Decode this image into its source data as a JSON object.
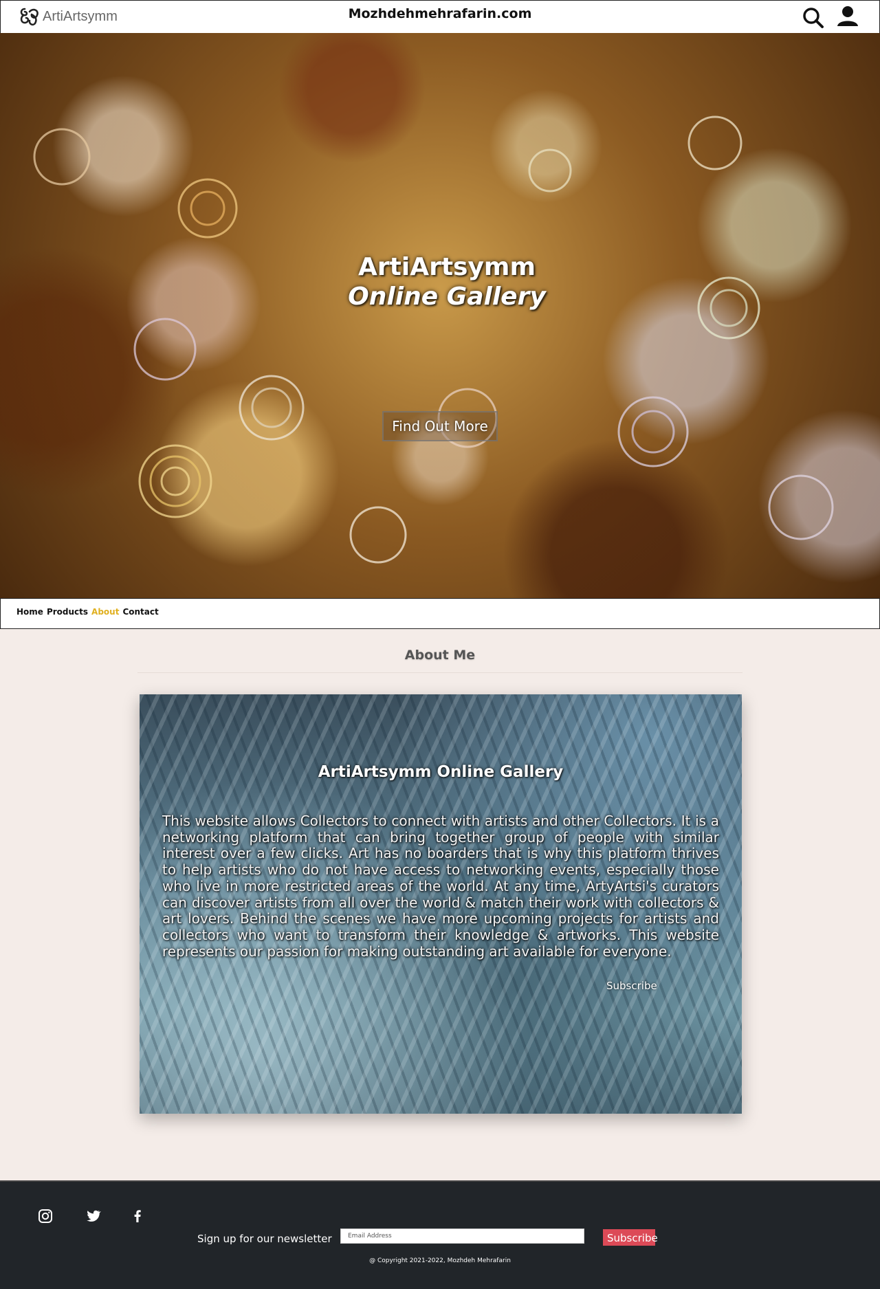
{
  "header": {
    "logo_text": "ArtiArtsymm",
    "site_title": "Mozhdehmehrafarin.com",
    "icons": [
      "search-icon",
      "user-icon"
    ]
  },
  "hero": {
    "line1": "ArtiArtsymm",
    "line2": "Online Gallery",
    "button_label": "Find Out More"
  },
  "nav": {
    "items": [
      {
        "label": "Home"
      },
      {
        "label": "Products"
      },
      {
        "label": "About",
        "active": true
      },
      {
        "label": "Contact"
      }
    ],
    "active_color": "#e0b020"
  },
  "about": {
    "section_title": "About Me",
    "card_title": "ArtiArtsymm Online Gallery",
    "card_text": "This website allows Collectors to connect with artists and other Collectors. It is a networking platform that can bring together group of people with similar interest over a few clicks. Art has no boarders that is why this platform thrives to help artists who do not have access to networking events, especially those who live in more restricted areas of the world. At any time, ArtyArtsi's curators can discover artists from all over the world & match their work with collectors & art lovers. Behind the scenes we have more upcoming projects for artists and collectors who want to transform their knowledge & artworks. This website represents our passion for making outstanding art available for everyone.",
    "subscribe_label": "Subscribe"
  },
  "footer": {
    "social_icons": [
      "instagram-icon",
      "twitter-icon",
      "facebook-icon"
    ],
    "newsletter_label": "Sign up for our newsletter",
    "email_placeholder": "Email Address",
    "subscribe_label": "Subscribe",
    "copyright": "@ Copyright 2021-2022, Mozhdeh Mehrafarin",
    "subscribe_color": "#dc4a57",
    "background_color": "#212529"
  }
}
